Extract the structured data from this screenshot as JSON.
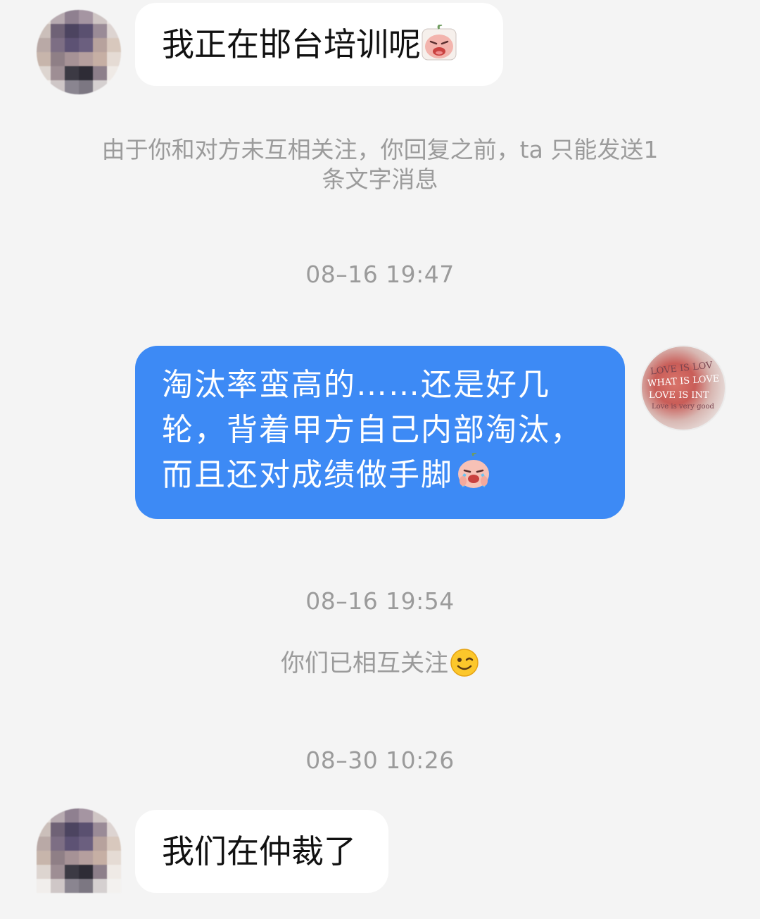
{
  "messages": [
    {
      "side": "left",
      "text": "我正在邯台培训呢"
    },
    {
      "side": "right",
      "text_lines": [
        "淘汰率蛮高的……还是好几",
        "轮，背着甲方自己内部淘汰，",
        "而且还对成绩做手脚"
      ]
    },
    {
      "side": "left",
      "text": "我们在仲裁了"
    }
  ],
  "system": {
    "notice_line1": "由于你和对方未互相关注，你回复之前，ta 只能发送1",
    "notice_line2": "条文字消息",
    "follow_notice": "你们已相互关注"
  },
  "timestamps": [
    "08–16 19:47",
    "08–16 19:54",
    "08–30 10:26"
  ],
  "avatar_lettering": [
    "LOVE IS LOV",
    "WHAT IS LOVE",
    "LOVE IS INT",
    "Love is very good"
  ],
  "colors": {
    "background": "#f4f4f4",
    "bubble_left": "#ffffff",
    "bubble_right": "#3d8af5",
    "system_text": "#9b9b9b"
  },
  "icons": {
    "emoji_1": "crying-peach-emoji-icon",
    "emoji_2": "sobbing-peach-emoji-icon",
    "emoji_3": "wink-emoji-icon"
  }
}
